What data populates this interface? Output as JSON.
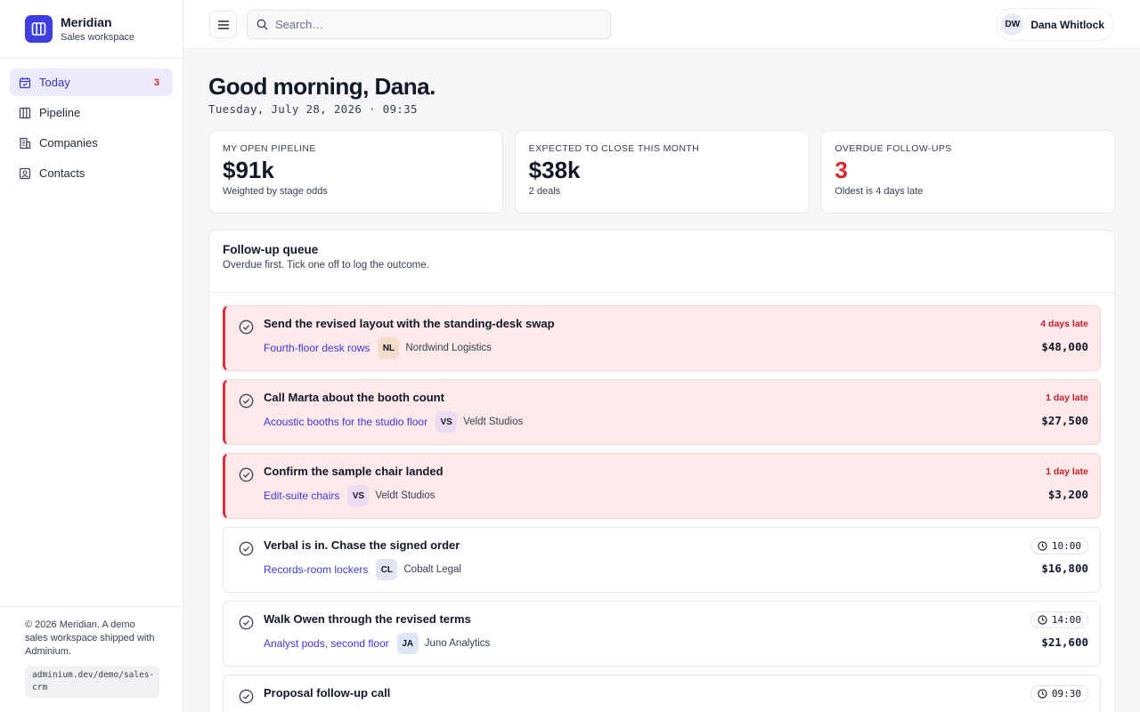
{
  "brand": {
    "name": "Meridian",
    "subtitle": "Sales workspace"
  },
  "nav": [
    {
      "label": "Today",
      "badge": "3",
      "icon": "calendar-icon",
      "active": true
    },
    {
      "label": "Pipeline",
      "badge": "",
      "icon": "columns-icon",
      "active": false
    },
    {
      "label": "Companies",
      "badge": "",
      "icon": "building-icon",
      "active": false
    },
    {
      "label": "Contacts",
      "badge": "",
      "icon": "contact-card-icon",
      "active": false
    }
  ],
  "footer": {
    "text": "© 2026 Meridian. A demo sales workspace shipped with Adminium.",
    "url": "adminium.dev/demo/sales-crm"
  },
  "topbar": {
    "search_placeholder": "Search…",
    "user_initials": "DW",
    "user_name": "Dana Whitlock"
  },
  "greeting": "Good morning, Dana.",
  "date": "Tuesday, July 28, 2026 · 09:35",
  "stats": [
    {
      "label": "MY OPEN PIPELINE",
      "value": "$91k",
      "note": "Weighted by stage odds",
      "danger": false
    },
    {
      "label": "EXPECTED TO CLOSE THIS MONTH",
      "value": "$38k",
      "note": "2 deals",
      "danger": false
    },
    {
      "label": "OVERDUE FOLLOW-UPS",
      "value": "3",
      "note": "Oldest is 4 days late",
      "danger": true
    }
  ],
  "queue": {
    "title": "Follow-up queue",
    "subtitle": "Overdue first. Tick one off to log the outcome.",
    "tasks": [
      {
        "title": "Send the revised layout with the standing-desk swap",
        "deal": "Fourth-floor desk rows",
        "company_initials": "NL",
        "company": "Nordwind Logistics",
        "status": "4 days late",
        "time": "",
        "amount": "$48,000",
        "late": true,
        "badge_color": "#f5dcc9"
      },
      {
        "title": "Call Marta about the booth count",
        "deal": "Acoustic booths for the studio floor",
        "company_initials": "VS",
        "company": "Veldt Studios",
        "status": "1 day late",
        "time": "",
        "amount": "$27,500",
        "late": true,
        "badge_color": "#ecdcf3"
      },
      {
        "title": "Confirm the sample chair landed",
        "deal": "Edit-suite chairs",
        "company_initials": "VS",
        "company": "Veldt Studios",
        "status": "1 day late",
        "time": "",
        "amount": "$3,200",
        "late": true,
        "badge_color": "#ecdcf3"
      },
      {
        "title": "Verbal is in. Chase the signed order",
        "deal": "Records-room lockers",
        "company_initials": "CL",
        "company": "Cobalt Legal",
        "status": "",
        "time": "10:00",
        "amount": "$16,800",
        "late": false,
        "badge_color": "#e3e5f3"
      },
      {
        "title": "Walk Owen through the revised terms",
        "deal": "Analyst pods, second floor",
        "company_initials": "JA",
        "company": "Juno Analytics",
        "status": "",
        "time": "14:00",
        "amount": "$21,600",
        "late": false,
        "badge_color": "#dde6f6"
      },
      {
        "title": "Proposal follow-up call",
        "deal": "",
        "company_initials": "",
        "company": "",
        "status": "",
        "time": "09:30",
        "amount": "",
        "late": false,
        "badge_color": "#f5e6d3"
      }
    ]
  }
}
